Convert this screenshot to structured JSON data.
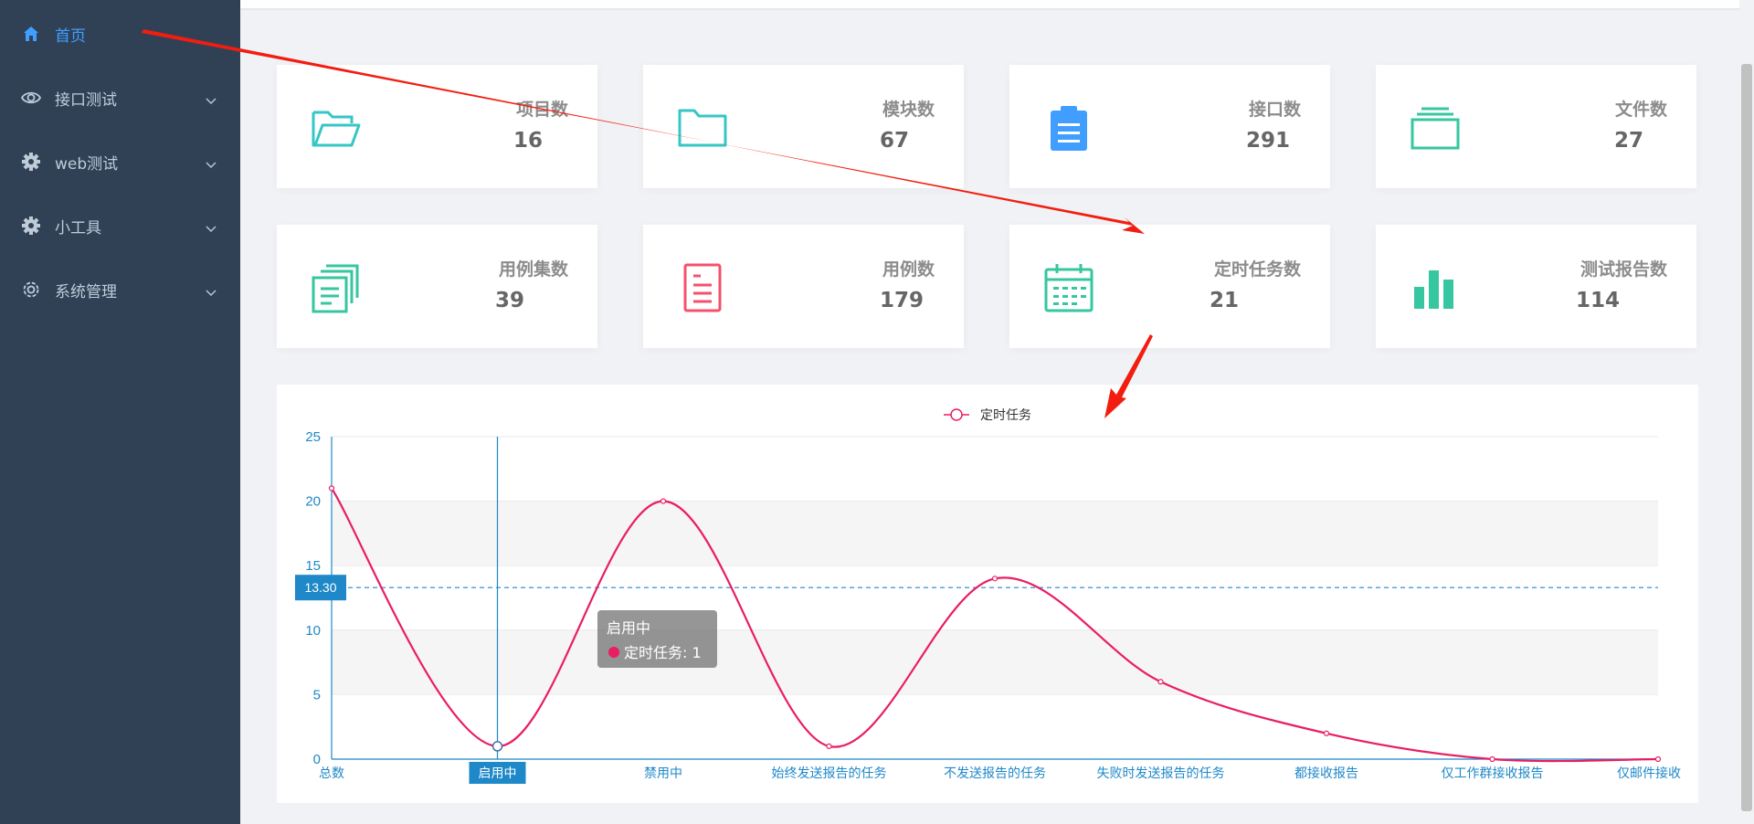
{
  "sidebar": {
    "items": [
      {
        "label": "首页",
        "icon": "home-icon",
        "active": true
      },
      {
        "label": "接口测试",
        "icon": "eye-icon",
        "active": false
      },
      {
        "label": "web测试",
        "icon": "gear-icon",
        "active": false
      },
      {
        "label": "小工具",
        "icon": "gear-icon",
        "active": false
      },
      {
        "label": "系统管理",
        "icon": "settings-icon",
        "active": false
      }
    ]
  },
  "stats": [
    {
      "title": "项目数",
      "value": "16",
      "icon": "folder-open-icon",
      "color": "#36c6c6"
    },
    {
      "title": "模块数",
      "value": "67",
      "icon": "folder-icon",
      "color": "#36c6c6"
    },
    {
      "title": "接口数",
      "value": "291",
      "icon": "clipboard-icon",
      "color": "#409eff"
    },
    {
      "title": "文件数",
      "value": "27",
      "icon": "files-icon",
      "color": "#36c6a0"
    },
    {
      "title": "用例集数",
      "value": "39",
      "icon": "copy-icon",
      "color": "#36c6a0"
    },
    {
      "title": "用例数",
      "value": "179",
      "icon": "document-icon",
      "color": "#f4516c"
    },
    {
      "title": "定时任务数",
      "value": "21",
      "icon": "calendar-icon",
      "color": "#36c6a0"
    },
    {
      "title": "测试报告数",
      "value": "114",
      "icon": "bar-chart-icon",
      "color": "#36c6a0"
    }
  ],
  "chart_data": {
    "type": "line",
    "categories": [
      "总数",
      "启用中",
      "禁用中",
      "始终发送报告的任务",
      "不发送报告的任务",
      "失败时发送报告的任务",
      "都接收报告",
      "仅工作群接收报告",
      "仅邮件接收"
    ],
    "series": [
      {
        "name": "定时任务",
        "values": [
          21,
          1,
          20,
          1,
          14,
          6,
          2,
          0,
          0
        ],
        "color": "#e91e63"
      }
    ],
    "ylim": [
      0,
      25
    ],
    "yticks": [
      0,
      5,
      10,
      15,
      20,
      25
    ],
    "average_line": {
      "value": 13.3,
      "label": "13.30",
      "color": "#1e88c8"
    },
    "axis_color": "#1e88c8",
    "tooltip": {
      "title": "启用中",
      "text": "定时任务: 1"
    },
    "highlighted_category_index": 1,
    "grid": true,
    "legend": "top-center"
  }
}
